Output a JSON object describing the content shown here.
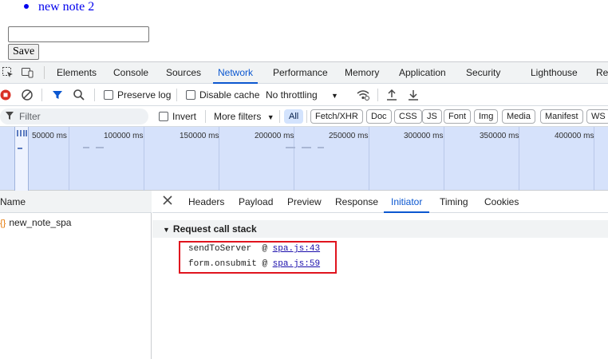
{
  "page": {
    "note_item": "new note 2",
    "input_value": "",
    "save_label": "Save"
  },
  "devtools": {
    "tabs": [
      "Elements",
      "Console",
      "Sources",
      "Network",
      "Performance",
      "Memory",
      "Application",
      "Security",
      "Lighthouse",
      "Rec"
    ],
    "active_tab": "Network",
    "toolbar": {
      "preserve_log": "Preserve log",
      "disable_cache": "Disable cache",
      "throttling": "No throttling"
    },
    "filter_bar": {
      "placeholder": "Filter",
      "invert": "Invert",
      "more_filters": "More filters",
      "chips": [
        "All",
        "Fetch/XHR",
        "Doc",
        "CSS",
        "JS",
        "Font",
        "Img",
        "Media",
        "Manifest",
        "WS"
      ],
      "active_chip": "All"
    },
    "timeline": {
      "labels": [
        "50000 ms",
        "100000 ms",
        "150000 ms",
        "200000 ms",
        "250000 ms",
        "300000 ms",
        "350000 ms",
        "400000 ms"
      ]
    },
    "requests": {
      "column_header": "Name",
      "rows": [
        "new_note_spa"
      ]
    },
    "details": {
      "tabs": [
        "Headers",
        "Payload",
        "Preview",
        "Response",
        "Initiator",
        "Timing",
        "Cookies"
      ],
      "active_tab": "Initiator",
      "section_title": "Request call stack",
      "call_stack": [
        {
          "fn": "sendToServer",
          "at": "@",
          "link": "spa.js:43"
        },
        {
          "fn": "form.onsubmit",
          "at": "@",
          "link": "spa.js:59"
        }
      ]
    }
  },
  "colors": {
    "accent": "#0b57d0",
    "highlight_border": "#e0141e",
    "overview_bg": "#d6e2fb"
  }
}
